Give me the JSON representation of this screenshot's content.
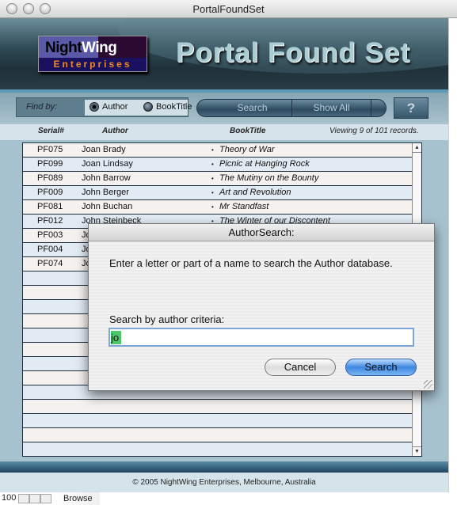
{
  "window": {
    "title": "PortalFoundSet"
  },
  "header": {
    "logo_top_dark": "Night",
    "logo_top_light": "Wing",
    "logo_bottom": "Enterprises",
    "page_title": "Portal Found Set"
  },
  "toolbar": {
    "find_by_label": "Find by:",
    "radio_author": "Author",
    "radio_booktitle": "BookTitle",
    "selected": "Author",
    "search_label": "Search",
    "show_all_label": "Show All",
    "help_label": "?"
  },
  "columns": {
    "serial": "Serial#",
    "author": "Author",
    "booktitle": "BookTitle",
    "record_status": "Viewing 9 of 101 records."
  },
  "rows": [
    {
      "serial": "PF075",
      "author": "Joan Brady",
      "title": "Theory of War"
    },
    {
      "serial": "PF099",
      "author": "Joan Lindsay",
      "title": "Picnic at Hanging Rock"
    },
    {
      "serial": "PF089",
      "author": "John Barrow",
      "title": "The Mutiny on the Bounty"
    },
    {
      "serial": "PF009",
      "author": "John Berger",
      "title": "Art and Revolution"
    },
    {
      "serial": "PF081",
      "author": "John Buchan",
      "title": "Mr Standfast"
    },
    {
      "serial": "PF012",
      "author": "John Steinbeck",
      "title": "The Winter of our Discontent"
    },
    {
      "serial": "PF003",
      "author": "Jo",
      "title": ""
    },
    {
      "serial": "PF004",
      "author": "Jo",
      "title": ""
    },
    {
      "serial": "PF074",
      "author": "Jo",
      "title": ""
    }
  ],
  "bullet": "•",
  "footer": {
    "copyright": "© 2005 NightWing Enterprises, Melbourne, Australia"
  },
  "statusbar": {
    "zoom": "100",
    "mode": "Browse"
  },
  "dialog": {
    "title": "AuthorSearch:",
    "message": "Enter a letter or part of a name to search the Author database.",
    "criteria_label": "Search by author criteria:",
    "criteria_value": "jo",
    "cancel_label": "Cancel",
    "search_label": "Search"
  }
}
